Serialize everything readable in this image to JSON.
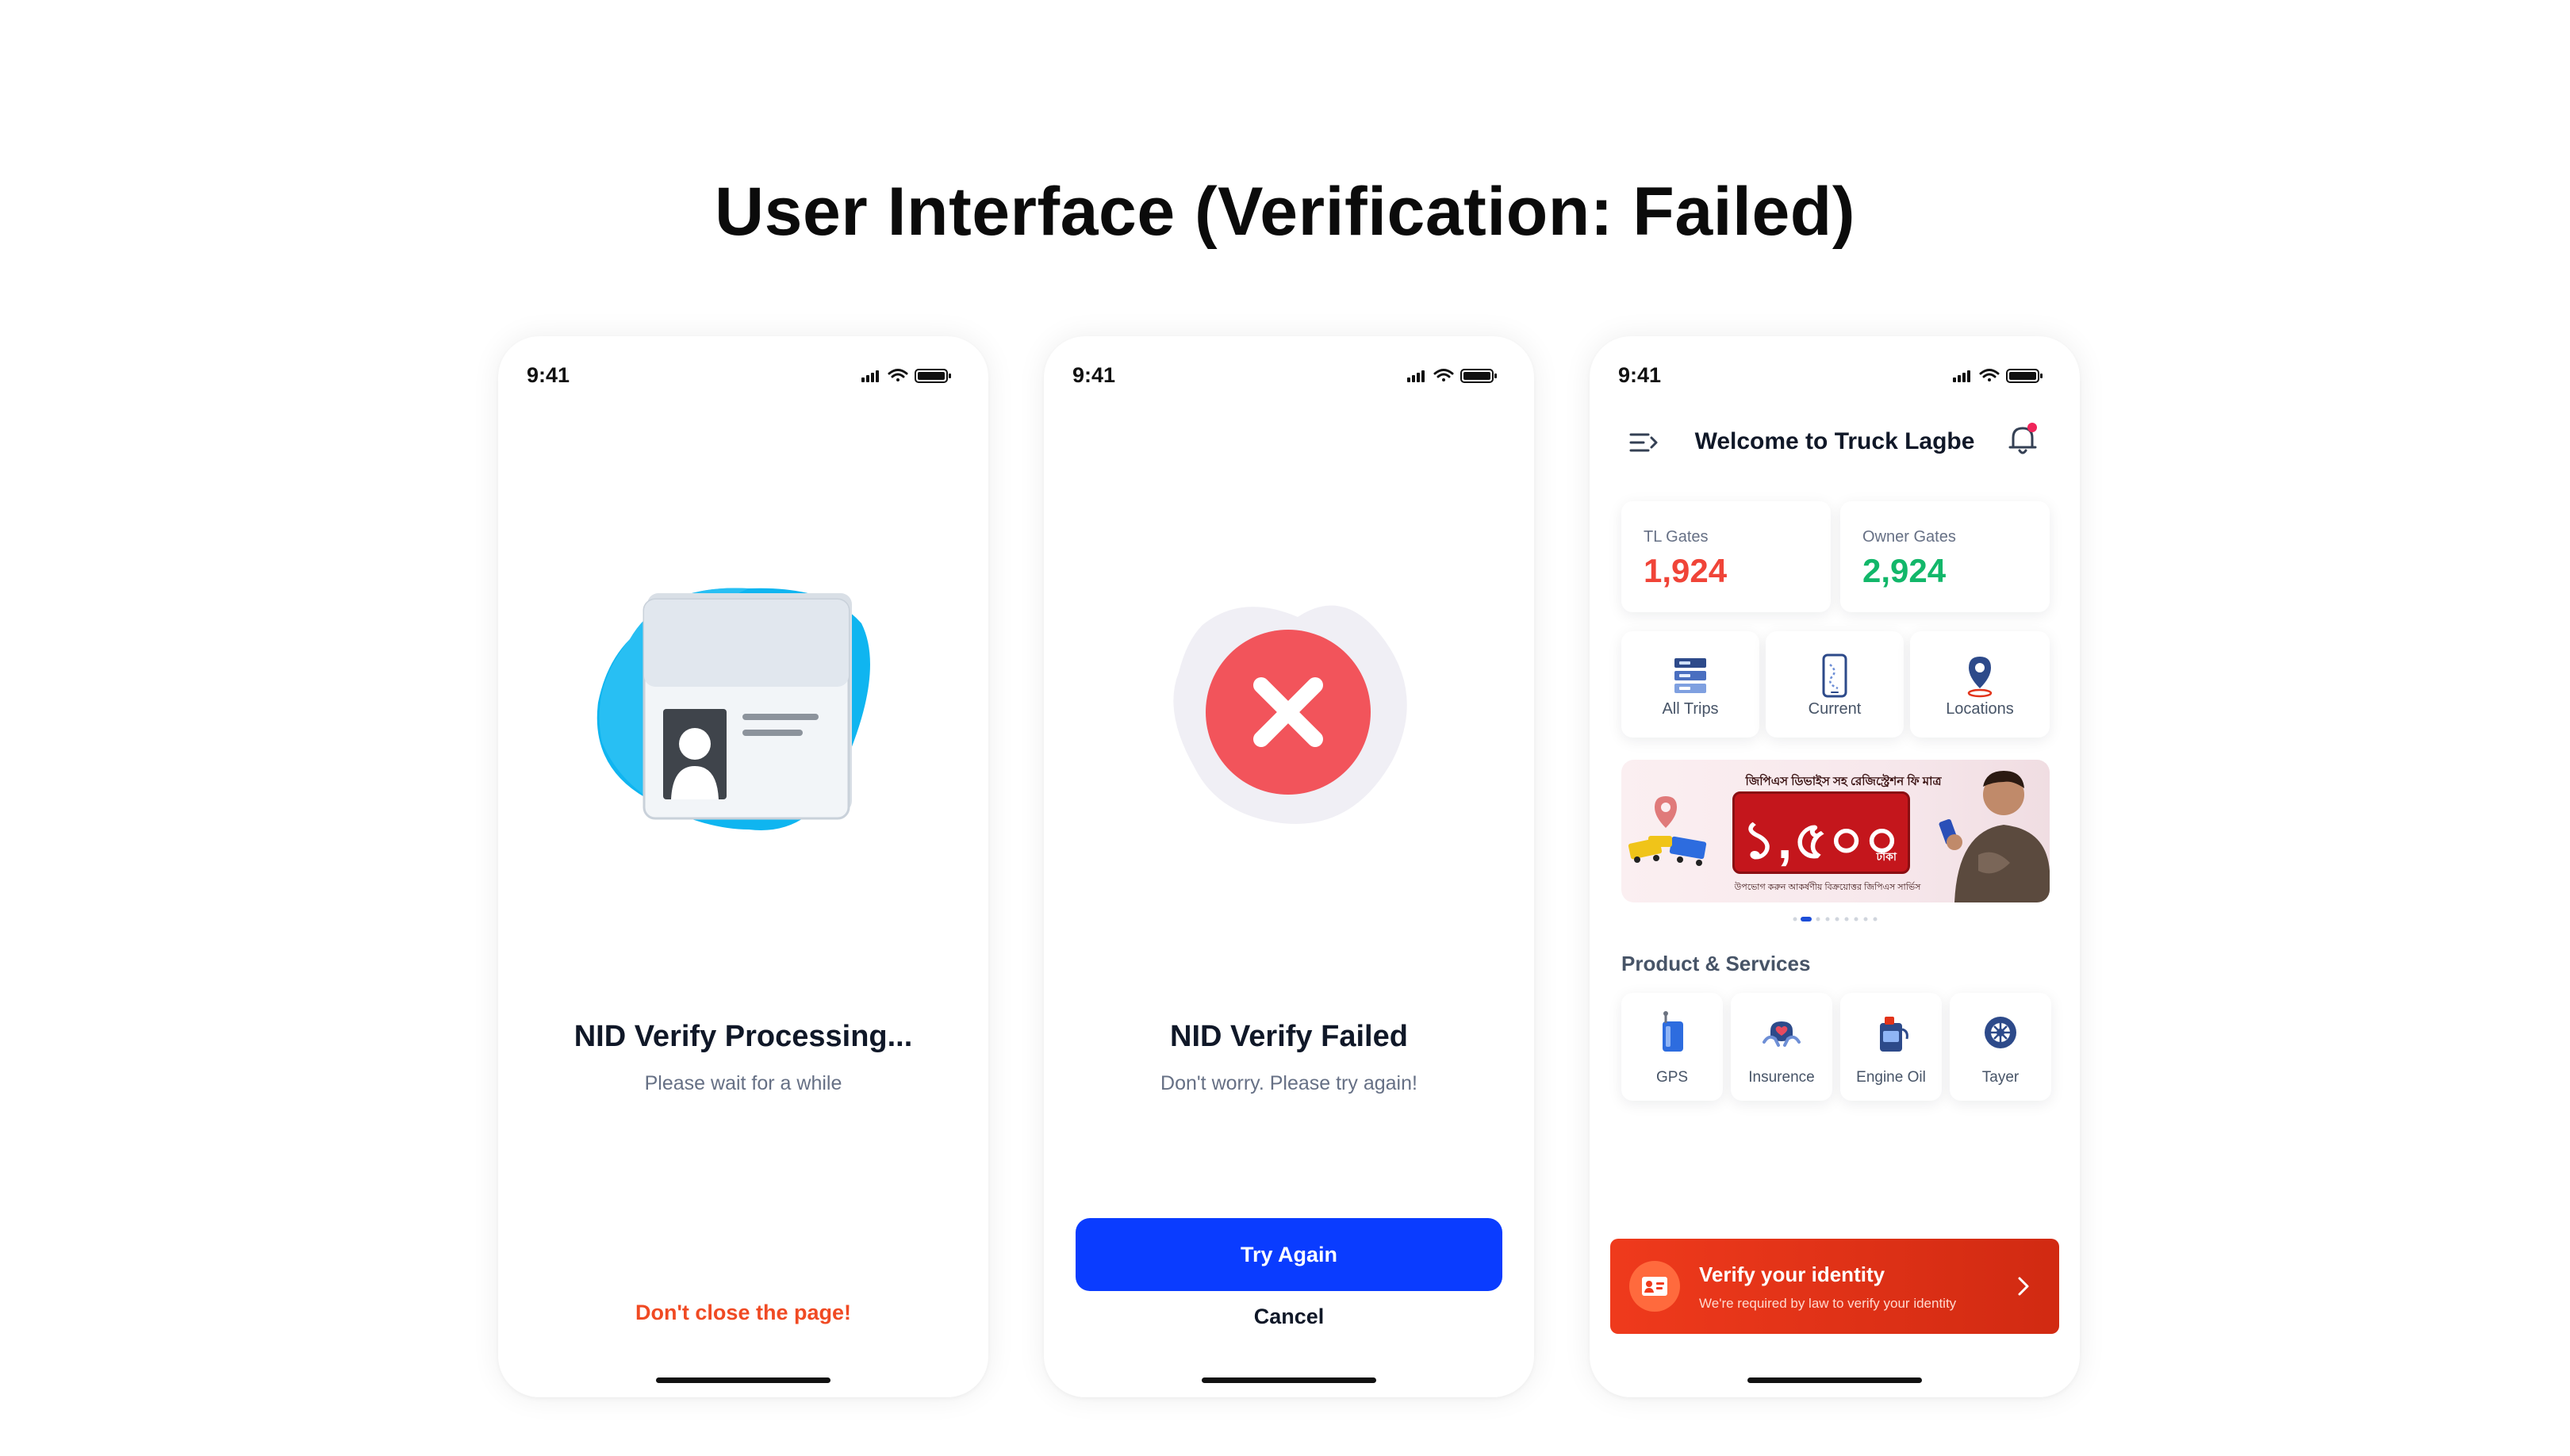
{
  "page": {
    "title": "User Interface (Verification: Failed)"
  },
  "screens": {
    "processing": {
      "time": "9:41",
      "title": "NID Verify Processing...",
      "subtitle": "Please wait for a while",
      "warning": "Don't close the page!"
    },
    "failed": {
      "time": "9:41",
      "title": "NID Verify Failed",
      "subtitle": "Don't worry. Please try again!",
      "primary_button": "Try Again",
      "secondary_button": "Cancel"
    },
    "home": {
      "time": "9:41",
      "header_title": "Welcome to Truck Lagbe",
      "stats": [
        {
          "label": "TL Gates",
          "value": "1,924",
          "color": "#f04438"
        },
        {
          "label": "Owner Gates",
          "value": "2,924",
          "color": "#12b76a"
        }
      ],
      "quick_actions": [
        {
          "label": "All Trips",
          "icon": "trips-stack-icon"
        },
        {
          "label": "Current",
          "icon": "phone-route-icon"
        },
        {
          "label": "Locations",
          "icon": "location-pin-icon"
        }
      ],
      "banner": {
        "top_text": "জিপিএস ডিভাইস সহ রেজিস্ট্রেশন ফি মাত্র",
        "amount": "১,৫০০",
        "unit": "টাকা",
        "bottom_text": "উপভোগ করুন আকর্ষণীয় বিক্রয়োত্তর জিপিএস সার্ভিস"
      },
      "section_title": "Product & Services",
      "services": [
        {
          "label": "GPS",
          "icon": "gps-device-icon"
        },
        {
          "label": "Insurence",
          "icon": "insurance-hands-icon"
        },
        {
          "label": "Engine Oil",
          "icon": "engine-oil-icon"
        },
        {
          "label": "Tayer",
          "icon": "tyre-icon"
        }
      ],
      "verify": {
        "title": "Verify your identity",
        "subtitle": "We're required by law to verify your identity"
      }
    }
  },
  "colors": {
    "primary_blue": "#0a3cff",
    "error_red": "#f04438",
    "success_green": "#12b76a",
    "warning_orange": "#f04a23",
    "verify_banner": "#e2331a"
  }
}
